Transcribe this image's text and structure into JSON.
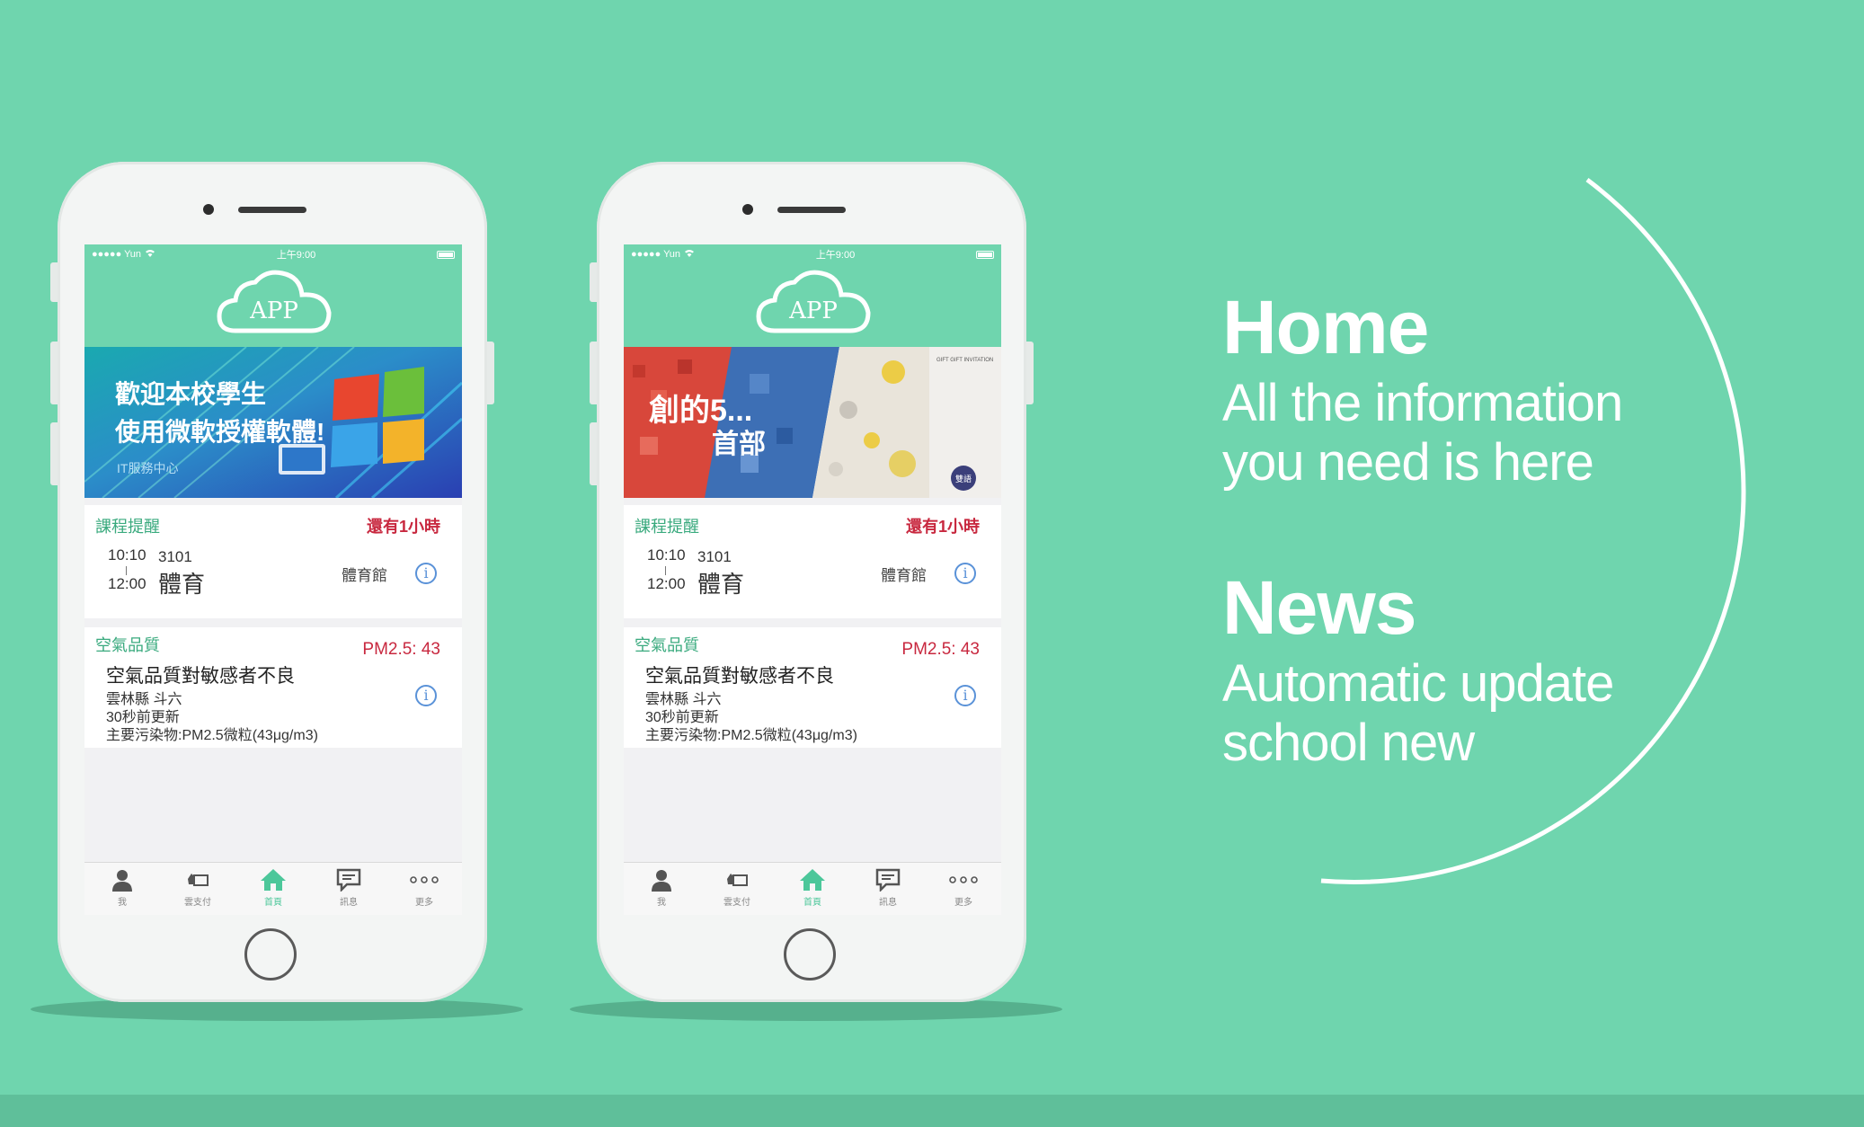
{
  "colors": {
    "background": "#6fd5ae",
    "accent_green": "#3aaa7e",
    "alert_red": "#c8283f",
    "info_blue": "#5a92d8",
    "white": "#ffffff"
  },
  "phones": [
    {
      "status": {
        "carrier": "●●●●● Yun",
        "time": "上午9:00"
      },
      "logo_text": "APP",
      "banner": {
        "line1": "歡迎本校學生",
        "line2": "使用微軟授權軟體!",
        "line3": "IT服務中心",
        "icon": "windows-logo-icon"
      },
      "course_card": {
        "title": "課程提醒",
        "countdown": "還有1小時",
        "start": "10:10",
        "end": "12:00",
        "room": "3101",
        "course": "體育",
        "place": "體育館"
      },
      "air_card": {
        "title": "空氣品質",
        "pm": "PM2.5: 43",
        "status": "空氣品質對敏感者不良",
        "location": "雲林縣 斗六",
        "updated": "30秒前更新",
        "pollutant": "主要污染物:PM2.5微粒(43μg/m3)"
      },
      "tabs": [
        {
          "label": "我",
          "icon": "person-icon"
        },
        {
          "label": "雲支付",
          "icon": "payment-icon"
        },
        {
          "label": "首頁",
          "icon": "home-icon"
        },
        {
          "label": "訊息",
          "icon": "message-icon"
        },
        {
          "label": "更多",
          "icon": "more-icon"
        }
      ],
      "active_tab": "首頁"
    },
    {
      "status": {
        "carrier": "●●●●● Yun",
        "time": "上午9:00"
      },
      "logo_text": "APP",
      "banner": {
        "line1": "創的5...",
        "line2": "首部",
        "tag": "GIFT GIFT INVITATION",
        "badge": "雙語"
      },
      "course_card": {
        "title": "課程提醒",
        "countdown": "還有1小時",
        "start": "10:10",
        "end": "12:00",
        "room": "3101",
        "course": "體育",
        "place": "體育館"
      },
      "air_card": {
        "title": "空氣品質",
        "pm": "PM2.5: 43",
        "status": "空氣品質對敏感者不良",
        "location": "雲林縣 斗六",
        "updated": "30秒前更新",
        "pollutant": "主要污染物:PM2.5微粒(43μg/m3)"
      },
      "tabs": [
        {
          "label": "我",
          "icon": "person-icon"
        },
        {
          "label": "雲支付",
          "icon": "payment-icon"
        },
        {
          "label": "首頁",
          "icon": "home-icon"
        },
        {
          "label": "訊息",
          "icon": "message-icon"
        },
        {
          "label": "更多",
          "icon": "more-icon"
        }
      ],
      "active_tab": "首頁"
    }
  ],
  "features": {
    "home_title": "Home",
    "home_line1": "All the information",
    "home_line2": "you need is here",
    "news_title": "News",
    "news_line1": "Automatic update",
    "news_line2": "school new"
  }
}
